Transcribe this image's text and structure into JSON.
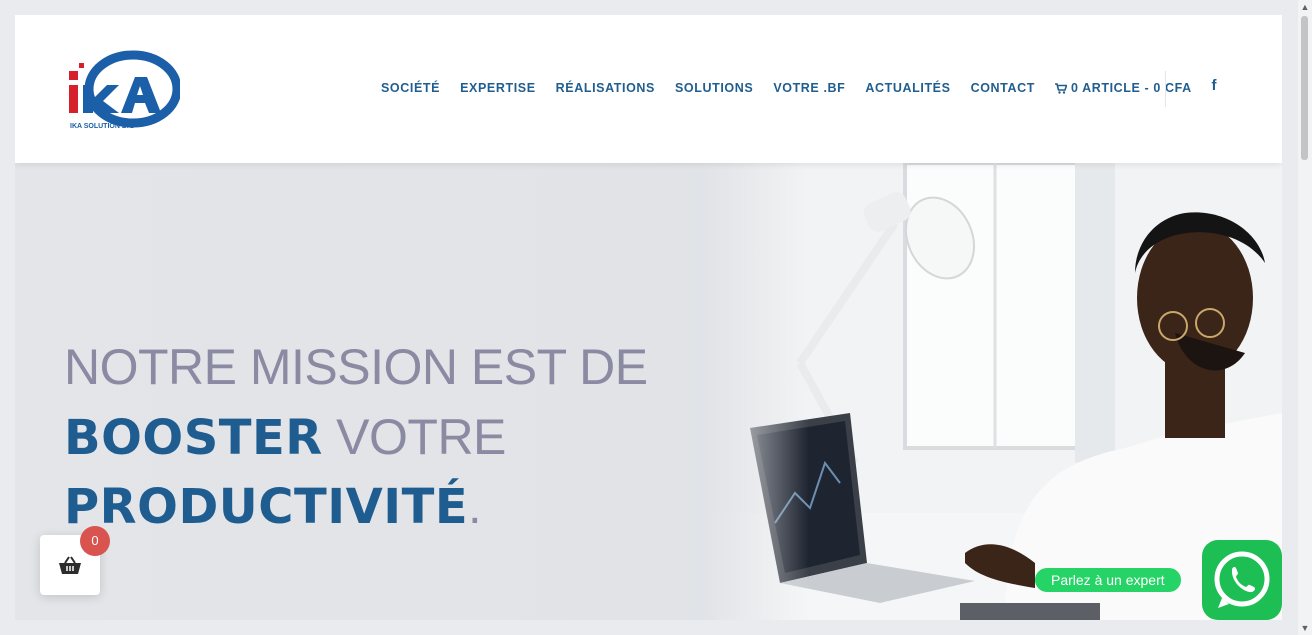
{
  "logo": {
    "caption": "IKA SOLUTION LTD",
    "mark": "IKA"
  },
  "nav": {
    "items": [
      "SOCIÉTÉ",
      "EXPERTISE",
      "RÉALISATIONS",
      "SOLUTIONS",
      "VOTRE .BF",
      "ACTUALITÉS",
      "CONTACT"
    ],
    "cart_label": "0 ARTICLE - 0 CFA",
    "facebook_glyph": "f"
  },
  "hero": {
    "line1": "NOTRE MISSION EST DE",
    "line2_bold": "BOOSTER",
    "line2_thin": " VOTRE",
    "line3_bold": "PRODUCTIVITÉ",
    "line3_period": "."
  },
  "floating_cart": {
    "count": "0",
    "icon": "basket-icon"
  },
  "whatsapp": {
    "label": "Parlez à un expert",
    "icon": "whatsapp-icon"
  },
  "colors": {
    "brand_blue": "#215e90",
    "thin_text": "#8a8aa3",
    "whatsapp_green": "#25d366",
    "badge_red": "#d9534f"
  }
}
